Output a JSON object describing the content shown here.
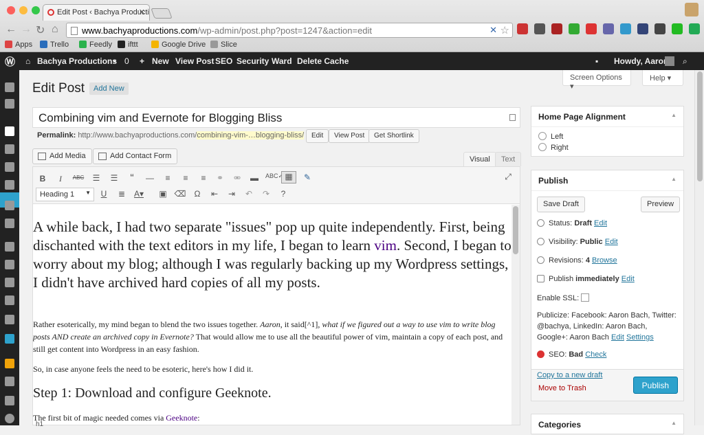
{
  "browser": {
    "tab_title": "Edit Post ‹ Bachya Productio",
    "url_host": "www.bachyaproductions.com",
    "url_path": "/wp-admin/post.php?post=1247&action=edit",
    "bookmarks": [
      "Apps",
      "Trello",
      "Feedly",
      "ifttt",
      "Google Drive",
      "Slice"
    ]
  },
  "adminbar": {
    "site": "Bachya Productions",
    "comments": "0",
    "new": "New",
    "view_post": "View Post",
    "seo": "SEO",
    "security": "Security",
    "ward": "Ward",
    "delete_cache": "Delete Cache",
    "howdy": "Howdy, Aaron"
  },
  "page": {
    "title": "Edit Post",
    "add_new": "Add New",
    "screen_options": "Screen Options",
    "help": "Help"
  },
  "post": {
    "title": "Combining vim and Evernote for Blogging Bliss",
    "permalink_label": "Permalink:",
    "permalink_base": "http://www.bachyaproductions.com/",
    "permalink_slug": "combining-vim-…blogging-bliss/",
    "edit_btn": "Edit",
    "view_post_btn": "View Post",
    "shortlink_btn": "Get Shortlink"
  },
  "editor": {
    "add_media": "Add Media",
    "add_contact_form": "Add Contact Form",
    "tab_visual": "Visual",
    "tab_text": "Text",
    "format": "Heading 1",
    "intro_a": "A while back, I had two separate \"issues\" pop up quite independently. First, being dischanted with the text editors in my life, I began to learn ",
    "intro_link": "vim",
    "intro_b": ". Second, I began to worry about my blog; although I was regularly backing up my Wordpress settings, I didn't have archived hard copies of all my posts.",
    "p1_a": "Rather esoterically, my mind began to blend the two issues together. ",
    "p1_b": "Aaron",
    "p1_c": ", it said[^1], ",
    "p1_d": "what if we figured out a way to use vim to write blog posts AND create an archived copy in Evernote?",
    "p1_e": " That would allow me to use all the beautiful power of vim, maintain a copy of each post, and still get content into Wordpress in an easy fashion.",
    "p2": "So, in case anyone feels the need to be esoteric, here's how I did it.",
    "h2": "Step 1: Download and configure Geeknote.",
    "p3_a": "The first bit of magic needed comes via ",
    "p3_link": "Geeknote",
    "p3_b": ":",
    "status": "h1"
  },
  "alignment_box": {
    "title": "Home Page Alignment",
    "left": "Left",
    "right": "Right"
  },
  "publish_box": {
    "title": "Publish",
    "save_draft": "Save Draft",
    "preview": "Preview",
    "status_label": "Status:",
    "status_value": "Draft",
    "visibility_label": "Visibility:",
    "visibility_value": "Public",
    "revisions_label": "Revisions:",
    "revisions_value": "4",
    "browse": "Browse",
    "publish_label": "Publish",
    "publish_value": "immediately",
    "edit": "Edit",
    "enable_ssl": "Enable SSL:",
    "publicize": "Publicize: Facebook: Aaron Bach, Twitter: @bachya, LinkedIn: Aaron Bach, Google+: Aaron Bach",
    "settings": "Settings",
    "seo_label": "SEO:",
    "seo_value": "Bad",
    "check": "Check",
    "copy_draft": "Copy to a new draft",
    "trash": "Move to Trash",
    "publish_btn": "Publish"
  },
  "categories_box": {
    "title": "Categories"
  },
  "colors": {
    "accent": "#2ea2cc",
    "link": "#21759b",
    "adminbar": "#222222"
  }
}
